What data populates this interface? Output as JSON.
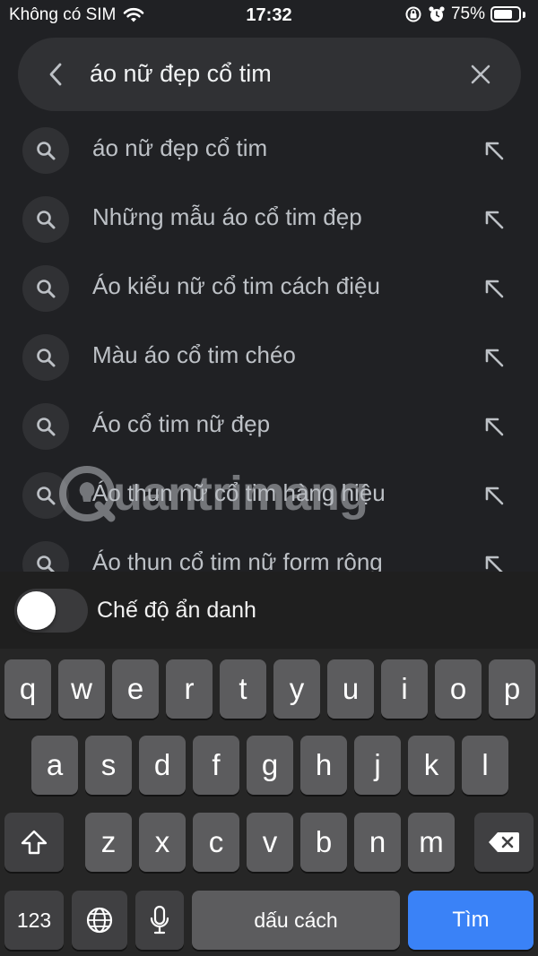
{
  "status": {
    "carrier": "Không có SIM",
    "time": "17:32",
    "battery": "75%",
    "battery_level": 0.75
  },
  "search": {
    "query": "áo nữ đẹp cổ tim"
  },
  "suggestions": [
    "áo nữ đẹp cổ tim",
    "Những mẫu áo cổ tim đẹp",
    "Áo kiểu nữ cổ tim cách điệu",
    "Màu áo cổ tim chéo",
    "Áo cổ tim nữ đẹp",
    "Áo thun nữ cổ tim hàng hiệu",
    "Áo thun cổ tim nữ form rộng"
  ],
  "watermark": {
    "text": "uantrimang"
  },
  "incognito": {
    "label": "Chế độ ẩn danh",
    "enabled": false
  },
  "keyboard": {
    "row1": [
      "q",
      "w",
      "e",
      "r",
      "t",
      "y",
      "u",
      "i",
      "o",
      "p"
    ],
    "row2": [
      "a",
      "s",
      "d",
      "f",
      "g",
      "h",
      "j",
      "k",
      "l"
    ],
    "row3": [
      "z",
      "x",
      "c",
      "v",
      "b",
      "n",
      "m"
    ],
    "numbers_label": "123",
    "space_label": "dấu cách",
    "go_label": "Tìm"
  },
  "icons": {
    "back": "chevron-left-icon",
    "clear": "close-icon",
    "suggestion": "search-icon",
    "fill": "arrow-up-left-icon",
    "shift": "shift-icon",
    "delete": "backspace-icon",
    "globe": "globe-icon",
    "mic": "microphone-icon"
  },
  "colors": {
    "accent": "#3a82f7",
    "background": "#202124",
    "surface": "#303134"
  }
}
